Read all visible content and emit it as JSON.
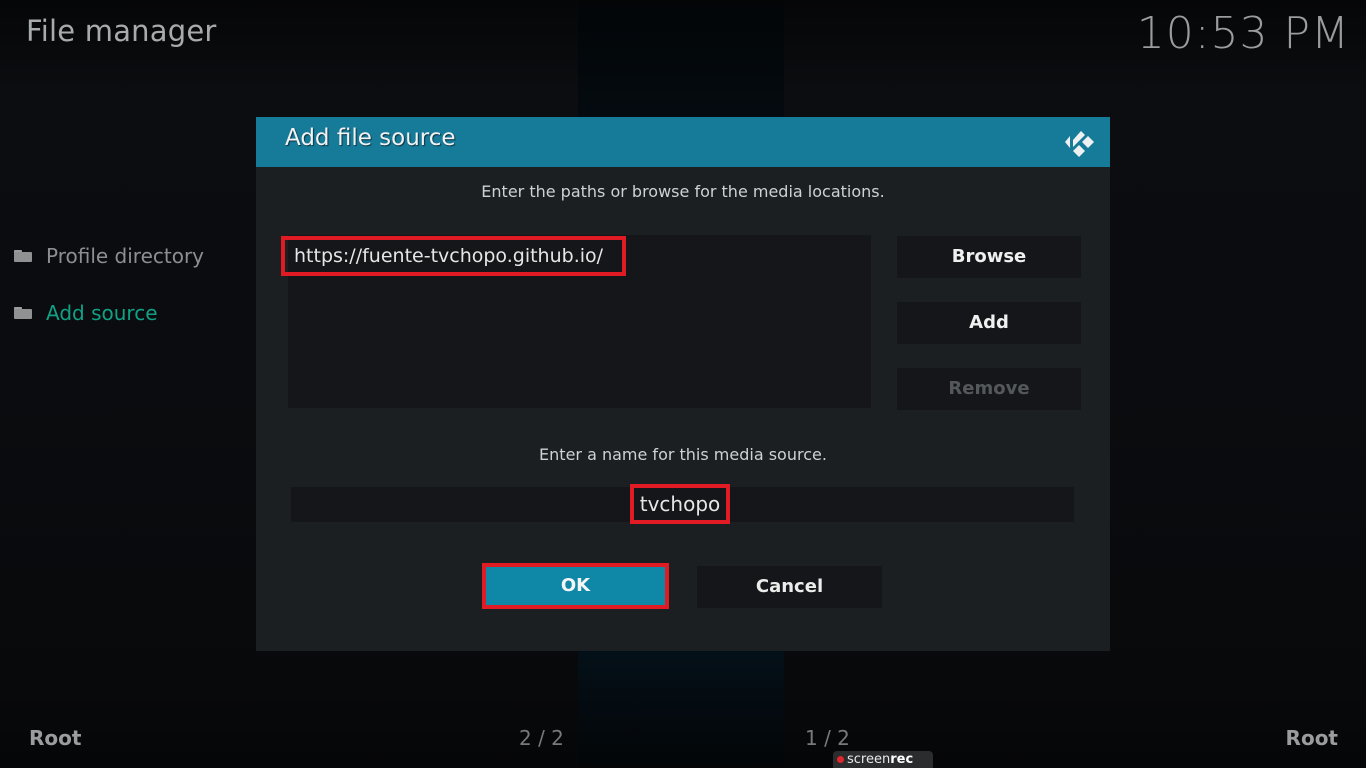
{
  "header": {
    "title": "File manager",
    "clock": "10:53 PM"
  },
  "sidebar": {
    "items": [
      {
        "label": "Profile directory",
        "icon": "folder-icon",
        "active": false
      },
      {
        "label": "Add source",
        "icon": "folder-icon",
        "active": true
      }
    ]
  },
  "dialog": {
    "title": "Add file source",
    "logo": "kodi-logo-icon",
    "paths_instruction": "Enter the paths or browse for the media locations.",
    "paths": [
      "https://fuente-tvchopo.github.io/"
    ],
    "buttons": {
      "browse": "Browse",
      "add": "Add",
      "remove": "Remove"
    },
    "name_instruction": "Enter a name for this media source.",
    "name_value": "tvchopo",
    "ok": "OK",
    "cancel": "Cancel"
  },
  "footer": {
    "left_label": "Root",
    "left_count": "2 / 2",
    "right_count": "1 / 2",
    "right_label": "Root"
  },
  "watermark": {
    "text_light": "screen",
    "text_bold": "rec"
  },
  "colors": {
    "accent": "#167a99",
    "ok_button": "#0f88a8",
    "highlight_border": "#e01b24",
    "active_item": "#12a085"
  }
}
